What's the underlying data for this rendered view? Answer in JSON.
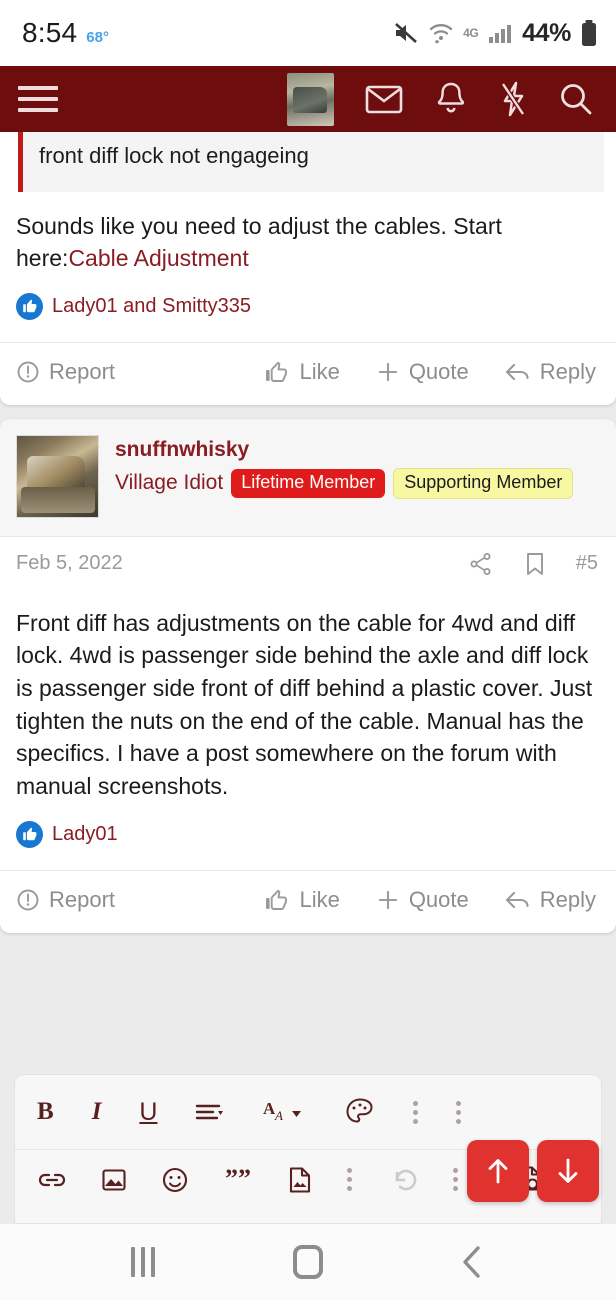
{
  "status_bar": {
    "time": "8:54",
    "temperature": "68°",
    "network_type": "4G",
    "battery_percent": "44%",
    "icons": [
      "mute-icon",
      "wifi-icon",
      "signal-icon",
      "battery-icon"
    ]
  },
  "header": {
    "menu_icon": "hamburger-menu-icon",
    "avatar_icon": "user-avatar-thumbnail",
    "icons": [
      "mail-icon",
      "bell-icon",
      "lightning-icon",
      "search-icon"
    ],
    "background_color": "#6d0d0d"
  },
  "quoted_post": {
    "title": "front diff lock not engageing",
    "accent_color": "#c01b1b"
  },
  "post_a": {
    "body_text": "Sounds like you need to adjust the cables. Start here:",
    "link_text": "Cable Adjustment",
    "link_color": "#8a1c23",
    "likes_names": "Lady01 and Smitty335",
    "actions": {
      "report": "Report",
      "like": "Like",
      "quote": "Quote",
      "reply": "Reply"
    }
  },
  "post_b": {
    "username": "snuffnwhisky",
    "user_title": "Village Idiot",
    "badges": [
      {
        "label": "Lifetime Member",
        "style": "red",
        "color": "#e01b1b"
      },
      {
        "label": "Supporting Member",
        "style": "yellow",
        "color": "#f8f8a2"
      }
    ],
    "date": "Feb 5, 2022",
    "post_number": "#5",
    "meta_icons": [
      "share-icon",
      "bookmark-icon"
    ],
    "body_text": "Front diff has adjustments on the cable for 4wd and diff lock. 4wd is passenger side behind the axle and diff lock is passenger side front of diff behind a plastic cover. Just tighten the nuts on the end of the cable. Manual has the specifics. I have a post somewhere on the forum with manual screenshots.",
    "likes_names": "Lady01",
    "actions": {
      "report": "Report",
      "like": "Like",
      "quote": "Quote",
      "reply": "Reply"
    }
  },
  "editor": {
    "row1_icons": [
      "bold-icon",
      "italic-icon",
      "underline-icon",
      "text-align-icon",
      "font-size-icon",
      "color-palette-icon",
      "more-options-icon",
      "more-options-icon"
    ],
    "row2_icons": [
      "link-icon",
      "insert-image-icon",
      "emoji-icon",
      "blockquote-icon",
      "attach-media-icon",
      "more-options-icon",
      "undo-icon",
      "more-options-icon",
      "preview-icon"
    ],
    "bold_label": "B",
    "italic_label": "I",
    "underline_label": "U",
    "font_label": "A"
  },
  "fab": {
    "scroll_up_icon": "arrow-up-icon",
    "scroll_down_icon": "arrow-down-icon",
    "color": "#e0322f"
  },
  "nav_bar": {
    "recents_icon": "recents-icon",
    "home_icon": "home-icon",
    "back_icon": "back-chevron-icon"
  }
}
